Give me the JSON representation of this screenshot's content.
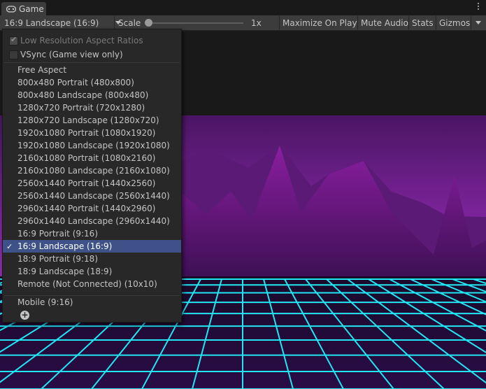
{
  "tab": {
    "title": "Game",
    "icon": "gamepad-icon"
  },
  "toolbar": {
    "aspect_label": "16:9 Landscape (16:9)",
    "scale_label": "Scale",
    "scale_value": "1x",
    "maximize_label": "Maximize On Play",
    "mute_label": "Mute Audio",
    "stats_label": "Stats",
    "gizmos_label": "Gizmos"
  },
  "menu": {
    "low_res_label": "Low Resolution Aspect Ratios",
    "low_res_checked": true,
    "vsync_label": "VSync (Game view only)",
    "vsync_checked": false,
    "items": [
      "Free Aspect",
      "800x480 Portrait (480x800)",
      "800x480 Landscape (800x480)",
      "1280x720 Portrait (720x1280)",
      "1280x720 Landscape (1280x720)",
      "1920x1080 Portrait (1080x1920)",
      "1920x1080 Landscape (1920x1080)",
      "2160x1080 Portrait (1080x2160)",
      "2160x1080 Landscape (2160x1080)",
      "2560x1440 Portrait (1440x2560)",
      "2560x1440 Landscape (2560x1440)",
      "2960x1440 Portrait (1440x2960)",
      "2960x1440 Landscape (2960x1440)",
      "16:9 Portrait (9:16)",
      "16:9 Landscape (16:9)",
      "18:9 Portrait (9:18)",
      "18:9 Landscape (18:9)",
      "Remote (Not Connected) (10x10)"
    ],
    "selected_item": "16:9 Landscape (16:9)",
    "extra_items": [
      "Mobile (9:16)"
    ],
    "add_icon": "plus-circle-icon",
    "check_icon": "checkmark-icon"
  },
  "colors": {
    "sky_top": "#4a1563",
    "sky_bottom": "#8a2aa8",
    "mountain": "#5e1978",
    "grid_line": "#22e6f2",
    "selection": "#3e5289"
  }
}
